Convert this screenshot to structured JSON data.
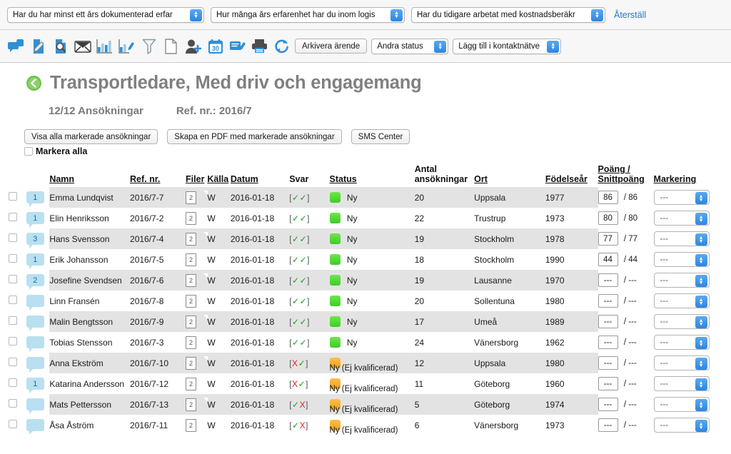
{
  "filter_bar": {
    "filters": [
      {
        "value": "Har du har minst ett års dokumenterad erfar"
      },
      {
        "value": "Hur många års erfarenhet har du inom logis"
      },
      {
        "value": "Har du tidigare arbetat med kostnadsberäkr"
      }
    ],
    "reset_label": "Återställ"
  },
  "toolbar": {
    "icons": [
      "comment-icon",
      "note-edit-icon",
      "document-search-icon",
      "mail-icon",
      "bar-chart-icon",
      "chart-edit-icon",
      "funnel-filter-icon",
      "blank-page-icon",
      "add-user-icon",
      "calendar-icon",
      "form-edit-icon",
      "print-icon",
      "refresh-icon"
    ],
    "archive_label": "Arkivera ärende",
    "change_status_label": "Ändra status",
    "add_to_network_label": "Lägg till i kontaktnätve"
  },
  "header": {
    "back_icon": "back-arrow-icon",
    "title": "Transportledare, Med driv och engagemang",
    "applications_count": "12/12 Ansökningar",
    "reference": "Ref. nr.: 2016/7"
  },
  "actions": {
    "view_all_label": "Visa alla markerade ansökningar",
    "create_pdf_label": "Skapa en PDF med markerade ansökningar",
    "sms_center_label": "SMS Center",
    "select_all_label": "Markera alla"
  },
  "table": {
    "columns": {
      "name": "Namn",
      "ref": "Ref. nr.",
      "files": "Filer",
      "source": "Källa",
      "date": "Datum",
      "reply": "Svar",
      "status": "Status",
      "count_line1": "Antal",
      "count_line2": "ansökningar",
      "city": "Ort",
      "birthyear": "Födelseår",
      "score_line1": "Poäng /",
      "score_line2": "Snittpoäng",
      "marking": "Markering"
    },
    "marking_placeholder": "---",
    "score_placeholder": "---",
    "rows": [
      {
        "badge": "1",
        "name": "Emma Lundqvist",
        "ref": "2016/7-7",
        "files": "2",
        "source": "W",
        "date": "2016-01-18",
        "reply": [
          "ok",
          "ok"
        ],
        "status_color": "green",
        "status": "Ny",
        "status_sub": "",
        "count": "20",
        "city": "Uppsala",
        "birthyear": "1977",
        "score": "86",
        "avg": "/ 86",
        "marking": "---"
      },
      {
        "badge": "1",
        "name": "Elin Henriksson",
        "ref": "2016/7-2",
        "files": "2",
        "source": "W",
        "date": "2016-01-18",
        "reply": [
          "ok",
          "ok"
        ],
        "status_color": "green",
        "status": "Ny",
        "status_sub": "",
        "count": "22",
        "city": "Trustrup",
        "birthyear": "1973",
        "score": "80",
        "avg": "/ 80",
        "marking": "---"
      },
      {
        "badge": "3",
        "name": "Hans Svensson",
        "ref": "2016/7-4",
        "files": "2",
        "source": "W",
        "date": "2016-01-18",
        "reply": [
          "ok",
          "ok"
        ],
        "status_color": "green",
        "status": "Ny",
        "status_sub": "",
        "count": "19",
        "city": "Stockholm",
        "birthyear": "1978",
        "score": "77",
        "avg": "/ 77",
        "marking": "---"
      },
      {
        "badge": "1",
        "name": "Erik Johansson",
        "ref": "2016/7-5",
        "files": "2",
        "source": "W",
        "date": "2016-01-18",
        "reply": [
          "ok",
          "ok"
        ],
        "status_color": "green",
        "status": "Ny",
        "status_sub": "",
        "count": "18",
        "city": "Stockholm",
        "birthyear": "1990",
        "score": "44",
        "avg": "/ 44",
        "marking": "---"
      },
      {
        "badge": "2",
        "name": "Josefine Svendsen",
        "ref": "2016/7-6",
        "files": "2",
        "source": "W",
        "date": "2016-01-18",
        "reply": [
          "ok",
          "ok"
        ],
        "status_color": "green",
        "status": "Ny",
        "status_sub": "",
        "count": "19",
        "city": "Lausanne",
        "birthyear": "1970",
        "score": "---",
        "avg": "/ ---",
        "marking": "---"
      },
      {
        "badge": "",
        "name": "Linn Fransén",
        "ref": "2016/7-8",
        "files": "2",
        "source": "W",
        "date": "2016-01-18",
        "reply": [
          "ok",
          "ok"
        ],
        "status_color": "green",
        "status": "Ny",
        "status_sub": "",
        "count": "20",
        "city": "Sollentuna",
        "birthyear": "1980",
        "score": "---",
        "avg": "/ ---",
        "marking": "---"
      },
      {
        "badge": "",
        "name": "Malin Bengtsson",
        "ref": "2016/7-9",
        "files": "2",
        "source": "W",
        "date": "2016-01-18",
        "reply": [
          "ok",
          "ok"
        ],
        "status_color": "green",
        "status": "Ny",
        "status_sub": "",
        "count": "17",
        "city": "Umeå",
        "birthyear": "1989",
        "score": "---",
        "avg": "/ ---",
        "marking": "---"
      },
      {
        "badge": "",
        "name": "Tobias Stensson",
        "ref": "2016/7-3",
        "files": "2",
        "source": "W",
        "date": "2016-01-18",
        "reply": [
          "ok",
          "ok"
        ],
        "status_color": "green",
        "status": "Ny",
        "status_sub": "",
        "count": "24",
        "city": "Vänersborg",
        "birthyear": "1962",
        "score": "---",
        "avg": "/ ---",
        "marking": "---"
      },
      {
        "badge": "",
        "name": "Anna Ekström",
        "ref": "2016/7-10",
        "files": "2",
        "source": "W",
        "date": "2016-01-18",
        "reply": [
          "bad",
          "ok"
        ],
        "status_color": "orange",
        "status": "",
        "status_sub": "Ny (Ej kvalificerad)",
        "count": "12",
        "city": "Uppsala",
        "birthyear": "1980",
        "score": "---",
        "avg": "/ ---",
        "marking": "---"
      },
      {
        "badge": "1",
        "name": "Katarina Andersson",
        "ref": "2016/7-12",
        "files": "2",
        "source": "W",
        "date": "2016-01-18",
        "reply": [
          "bad",
          "ok"
        ],
        "status_color": "orange",
        "status": "",
        "status_sub": "Ny (Ej kvalificerad)",
        "count": "11",
        "city": "Göteborg",
        "birthyear": "1960",
        "score": "---",
        "avg": "/ ---",
        "marking": "---"
      },
      {
        "badge": "",
        "name": "Mats Pettersson",
        "ref": "2016/7-13",
        "files": "2",
        "source": "W",
        "date": "2016-01-18",
        "reply": [
          "ok",
          "bad"
        ],
        "status_color": "orange",
        "status": "",
        "status_sub": "Ny (Ej kvalificerad)",
        "count": "5",
        "city": "Göteborg",
        "birthyear": "1974",
        "score": "---",
        "avg": "/ ---",
        "marking": "---"
      },
      {
        "badge": "",
        "name": "Åsa Åström",
        "ref": "2016/7-11",
        "files": "2",
        "source": "W",
        "date": "2016-01-18",
        "reply": [
          "ok",
          "bad"
        ],
        "status_color": "orange",
        "status": "",
        "status_sub": "Ny (Ej kvalificerad)",
        "count": "6",
        "city": "Vänersborg",
        "birthyear": "1973",
        "score": "---",
        "avg": "/ ---",
        "marking": "---"
      }
    ]
  },
  "colors": {
    "accent_blue": "#2b76d0",
    "status_green": "#3dcc28",
    "status_orange": "#f0a01c",
    "title_gray": "#808080",
    "badge_blue": "#b9e0f0"
  }
}
